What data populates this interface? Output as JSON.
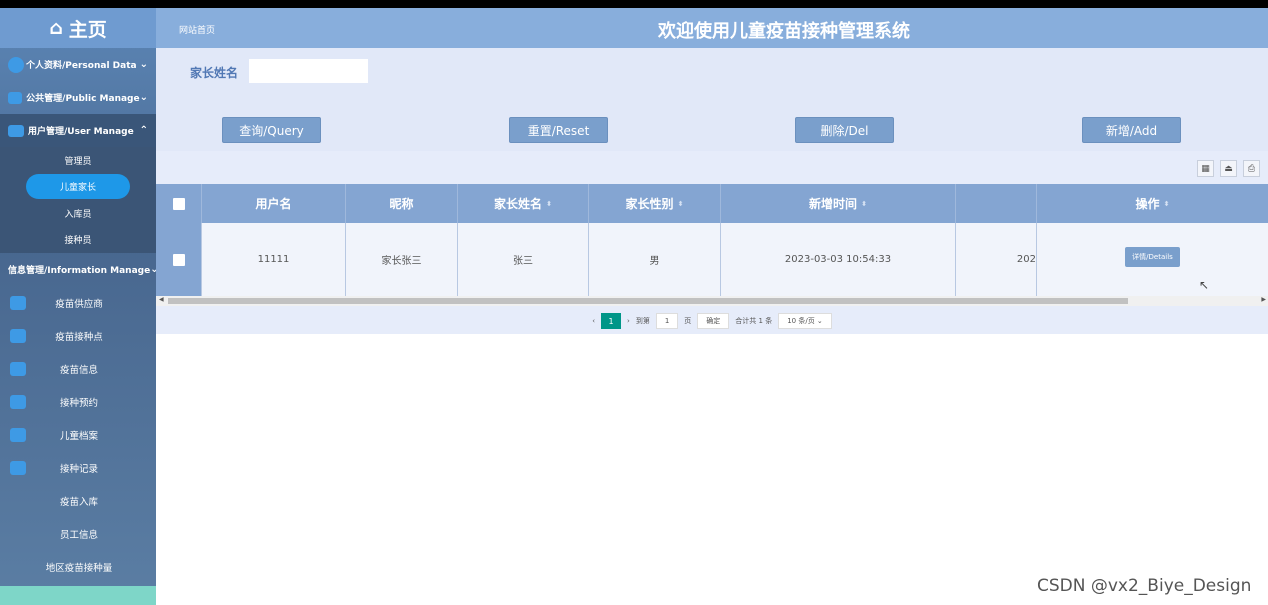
{
  "sidebar": {
    "home_label": "主页",
    "menus": [
      {
        "label": "个人资料/Personal Data"
      },
      {
        "label": "公共管理/Public Manage"
      },
      {
        "label": "用户管理/User Manage"
      }
    ],
    "sub_items": [
      {
        "label": "管理员"
      },
      {
        "label": "儿童家长"
      },
      {
        "label": "入库员"
      },
      {
        "label": "接种员"
      }
    ],
    "info_menu": {
      "label": "信息管理/Information Manage"
    },
    "info_items": [
      {
        "label": "疫苗供应商"
      },
      {
        "label": "疫苗接种点"
      },
      {
        "label": "疫苗信息"
      },
      {
        "label": "接种预约"
      },
      {
        "label": "儿童档案"
      },
      {
        "label": "接种记录"
      },
      {
        "label": "疫苗入库"
      },
      {
        "label": "员工信息"
      },
      {
        "label": "地区疫苗接种量"
      }
    ]
  },
  "header": {
    "breadcrumb": "网站首页",
    "title": "欢迎使用儿童疫苗接种管理系统"
  },
  "search": {
    "label": "家长姓名",
    "value": ""
  },
  "buttons": {
    "query": "查询/Query",
    "reset": "重置/Reset",
    "del": "删除/Del",
    "add": "新增/Add"
  },
  "table": {
    "columns": [
      "用户名",
      "昵称",
      "家长姓名",
      "家长性别",
      "新增时间",
      "",
      "操作"
    ],
    "rows": [
      {
        "username": "11111",
        "nickname": "家长张三",
        "parent_name": "张三",
        "gender": "男",
        "created": "2023-03-03 10:54:33",
        "extra": "202",
        "action": "详情/Details"
      }
    ]
  },
  "pager": {
    "current": "1",
    "goto_label": "到第",
    "goto_value": "1",
    "page_suffix": "页",
    "confirm": "确定",
    "total": "合计共 1 条",
    "page_size": "10 条/页"
  },
  "watermark": "CSDN @vx2_Biye_Design"
}
